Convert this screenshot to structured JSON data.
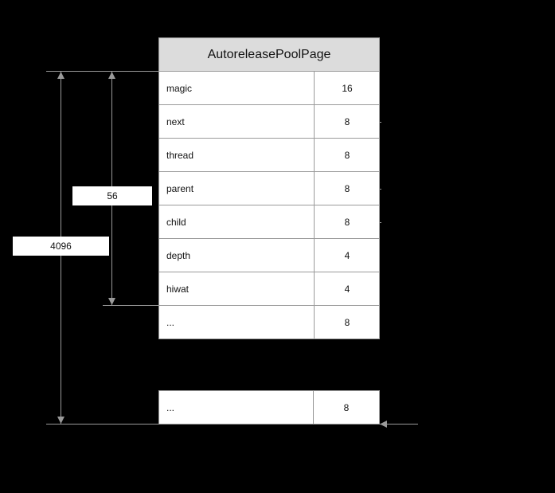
{
  "diagram": {
    "title": "AutoreleasePoolPage",
    "rows": [
      {
        "name": "magic",
        "size": "16"
      },
      {
        "name": "next",
        "size": "8"
      },
      {
        "name": "thread",
        "size": "8"
      },
      {
        "name": "parent",
        "size": "8"
      },
      {
        "name": "child",
        "size": "8"
      },
      {
        "name": "depth",
        "size": "4"
      },
      {
        "name": "hiwat",
        "size": "4"
      },
      {
        "name": "...",
        "size": "8"
      }
    ],
    "tail_row": {
      "name": "...",
      "size": "8"
    },
    "header_size_label": "56",
    "page_size_label": "4096"
  },
  "colors": {
    "background": "#000000",
    "line": "#9a9a9a",
    "header_fill": "#dcdcdc",
    "cell_fill": "#ffffff"
  }
}
